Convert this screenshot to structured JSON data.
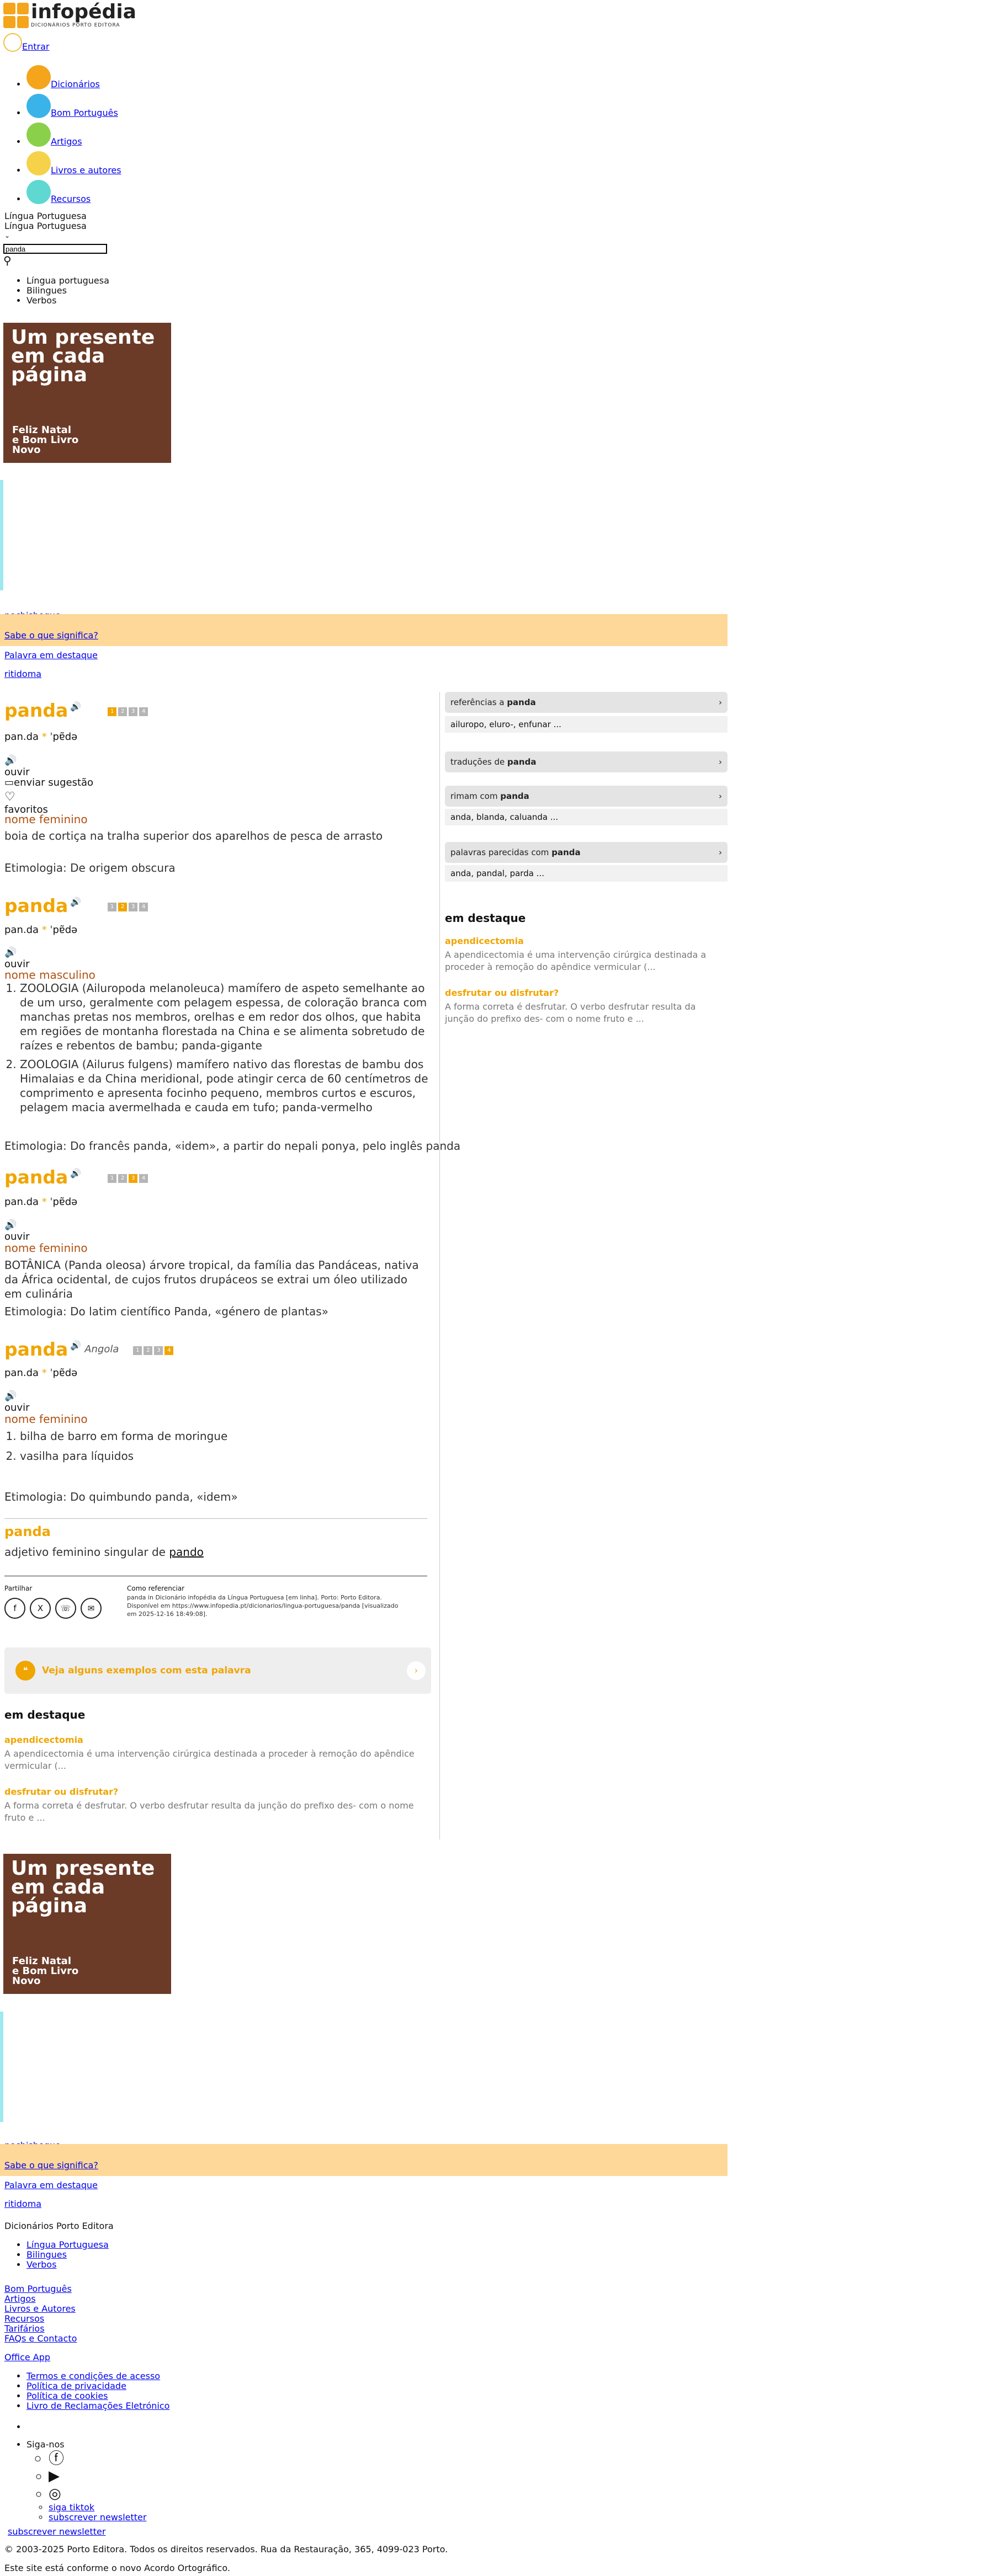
{
  "header": {
    "brand": "infopédia",
    "brand_sub": "DICIONÁRIOS PORTO EDITORA",
    "login_label": "Entrar",
    "nav": [
      {
        "label": "Dicionários",
        "icon": "dictionary-icon",
        "color": "#f4a51c"
      },
      {
        "label": "Bom Português",
        "icon": "pen-icon",
        "color": "#3ab4e8"
      },
      {
        "label": "Artigos",
        "icon": "article-icon",
        "color": "#8bd04a"
      },
      {
        "label": "Livros e autores",
        "icon": "book-icon",
        "color": "#f6d24a"
      },
      {
        "label": "Recursos",
        "icon": "resources-icon",
        "color": "#5ed8d0"
      }
    ],
    "dictionary_select": "Língua Portuguesa",
    "dictionary_select_2": "Língua Portuguesa",
    "search_value": "panda",
    "dict_menu": [
      "Língua portuguesa",
      "Bilingues",
      "Verbos"
    ]
  },
  "banner": {
    "line1": "Um presente",
    "line2": "em cada",
    "line3": "página",
    "line4": "Feliz Natal",
    "line5": "e Bom Livro",
    "line6": "Novo"
  },
  "promo_links": {
    "word1": "pechisbeque",
    "know": "Sabe o que significa?",
    "word_label": "Palavra em destaque",
    "word2": "ritidoma"
  },
  "entries": [
    {
      "title": "panda",
      "syll": "pan.da",
      "pron": "ˈpɐ̃də",
      "gram": "nome feminino",
      "tags": [
        "1",
        "2",
        "3",
        "4"
      ],
      "active": 0,
      "senses": [
        "boia de cortiça na tralha superior dos aparelhos de pesca de arrasto"
      ],
      "etym": "Etimologia: De origem obscura"
    },
    {
      "title": "panda",
      "syll": "pan.da",
      "pron": "ˈpɐ̃də",
      "gram": "nome masculino",
      "tags": [
        "1",
        "2",
        "3",
        "4"
      ],
      "active": 1,
      "senses": [
        "ZOOLOGIA (Ailuropoda melanoleuca) mamífero de aspeto semelhante ao de um urso, geralmente com pelagem espessa, de coloração branca com manchas pretas nos membros, orelhas e em redor dos olhos, que habita em regiões de montanha florestada na China e se alimenta sobretudo de raízes e rebentos de bambu; panda-gigante",
        "ZOOLOGIA (Ailurus fulgens) mamífero nativo das florestas de bambu dos Himalaias e da China meridional, pode atingir cerca de 60 centímetros de comprimento e apresenta focinho pequeno, membros curtos e escuros, pelagem macia avermelhada e cauda em tufo; panda-vermelho"
      ],
      "etym": "Etimologia: Do francês panda, «idem», a partir do nepali ponya, pelo inglês panda"
    },
    {
      "title": "panda",
      "syll": "pan.da",
      "pron": "ˈpɐ̃də",
      "gram": "nome feminino",
      "tags": [
        "1",
        "2",
        "3",
        "4"
      ],
      "active": 2,
      "senses": [
        "BOTÂNICA (Panda oleosa) árvore tropical, da família das Pandáceas, nativa da África ocidental, de cujos frutos drupáceos se extrai um óleo utilizado em culinária"
      ],
      "etym": "Etimologia: Do latim científico Panda, «género de plantas»"
    },
    {
      "title": "panda",
      "region": "Angola",
      "syll": "pan.da",
      "pron": "ˈpɐ̃də",
      "gram": "nome feminino",
      "tags": [
        "1",
        "2",
        "3",
        "4"
      ],
      "active": 3,
      "senses": [
        "bilha de barro em forma de moringue",
        "vasilha para líquidos"
      ],
      "etym": "Etimologia: Do quimbundo panda, «idem»"
    }
  ],
  "listen_label": "ouvir",
  "suggest_label": "enviar sugestão",
  "fav_label": "favoritos",
  "inflection": {
    "title": "panda",
    "text": "adjetivo feminino singular de",
    "link": "pando"
  },
  "share": {
    "label": "Partilhar",
    "cite_label": "Como referenciar",
    "cite_text": "panda in Dicionário infopédia da Língua Portuguesa [em linha]. Porto: Porto Editora. Disponível em https://www.infopedia.pt/dicionarios/lingua-portuguesa/panda [visualizado em 2025-12-16 18:49:08]."
  },
  "examples_label": "Veja alguns exemplos com esta palavra",
  "destaque": {
    "title": "em destaque",
    "items": [
      {
        "title": "apendicectomia",
        "text": "A apendicectomia é uma intervenção cirúrgica destinada a proceder à remoção do apêndice vermicular (...",
        "text_side": "A apendicectomia é uma intervenção cirúrgica destinada a proceder à remoção do apêndice vermicular (..."
      },
      {
        "title": "desfrutar ou disfrutar?",
        "text": "A forma correta é desfrutar. O verbo desfrutar resulta da junção do prefixo des- com o nome fruto e ...",
        "text_side": "A forma correta é desfrutar. O verbo desfrutar resulta da junção do prefixo des- com o nome fruto e ..."
      }
    ]
  },
  "sidebar": {
    "refs_title": "referências a",
    "refs_word": "panda",
    "refs_links": "ailuropo, eluro-, enfunar ...",
    "trans_title": "traduções de",
    "trans_word": "panda",
    "rhyme_title": "rimam com",
    "rhyme_word": "panda",
    "rhyme_links": "anda, blanda, caluanda ...",
    "similar_title": "palavras parecidas com",
    "similar_word": "panda",
    "similar_links": "anda, pandal, parda ..."
  },
  "footer": {
    "brand": "Dicionários Porto Editora",
    "dict_links": [
      "Língua Portuguesa",
      "Bilingues",
      "Verbos"
    ],
    "links": [
      "Bom Português",
      "Artigos",
      "Livros e Autores",
      "Recursos",
      "Tarifários",
      "FAQs e Contacto"
    ],
    "office": "Office App",
    "legal": [
      "Termos e condições de acesso",
      "Política de privacidade",
      "Política de cookies",
      "Livro de Reclamações Eletrónico"
    ],
    "follow": "Siga-nos",
    "tiktok": "siga tiktok",
    "newsletter": "subscrever newsletter",
    "newsletter2": "subscrever newsletter",
    "copyright": "© 2003-2025 Porto Editora. Todos os direitos reservados. Rua da Restauração, 365, 4099-023 Porto.",
    "ao": "Este site está conforme o novo Acordo Ortográfico."
  }
}
